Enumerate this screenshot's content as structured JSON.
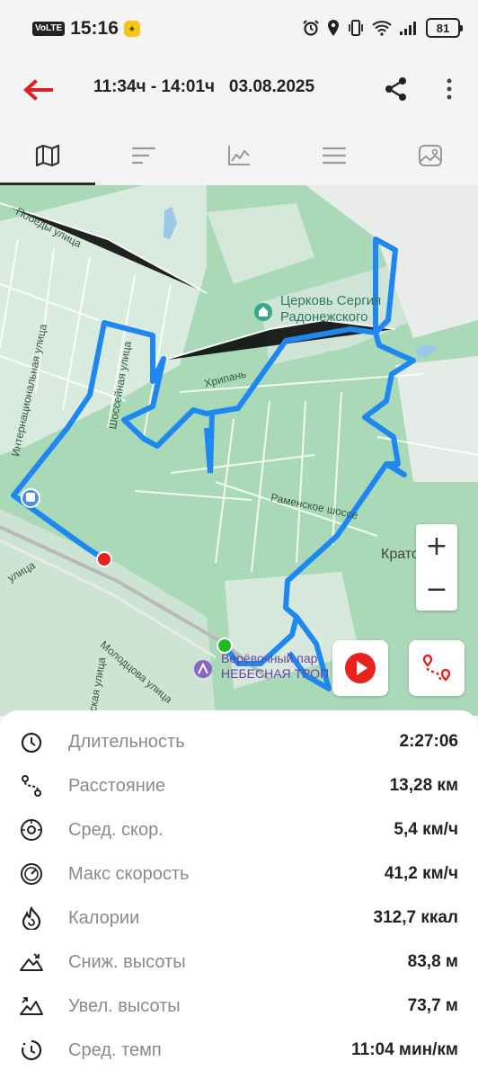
{
  "status_bar": {
    "network": "VoLTE",
    "time": "15:16",
    "notification_icon": "app-notification-icon",
    "battery": "81"
  },
  "header": {
    "title": "11:34ч - 14:01ч   03.08.2025",
    "back_icon": "arrow-left-icon",
    "share_icon": "share-icon",
    "more_icon": "more-vertical-icon"
  },
  "tabs": [
    {
      "icon": "map-icon",
      "active": true
    },
    {
      "icon": "sort-lines-icon",
      "active": false
    },
    {
      "icon": "line-chart-icon",
      "active": false
    },
    {
      "icon": "menu-lines-icon",
      "active": false
    },
    {
      "icon": "photo-icon",
      "active": false
    }
  ],
  "map": {
    "streets": {
      "pobedy": "Победы улица",
      "internatsionalnaya": "Интернациональная улица",
      "shosseynaya": "Шоссейная улица",
      "khripan": "Хрипань",
      "ramenskoe": "Раменское шоссе",
      "ulitsa": "улица",
      "molodtsova": "Молодцова улица",
      "skaya": "ская улица"
    },
    "church": [
      "Церковь Сергия",
      "Радонежского"
    ],
    "park": [
      "Верёвочный пар",
      "НЕБЕСНАЯ ТРОП"
    ],
    "town": "Кратово",
    "zoom_in": "+",
    "zoom_out": "−",
    "colors": {
      "route": "#1e88f0",
      "start": "#22bb22",
      "end": "#e8231e",
      "water": "#9cc8e8"
    }
  },
  "stats": [
    {
      "icon": "stopwatch-icon",
      "label": "Длительность",
      "value": "2:27:06"
    },
    {
      "icon": "route-distance-icon",
      "label": "Расстояние",
      "value": "13,28 км"
    },
    {
      "icon": "speedometer-icon",
      "label": "Сред. скор.",
      "value": "5,4 км/ч"
    },
    {
      "icon": "max-speed-icon",
      "label": "Макс скорость",
      "value": "41,2 км/ч"
    },
    {
      "icon": "calories-flame-icon",
      "label": "Калории",
      "value": "312,7 ккал"
    },
    {
      "icon": "descent-icon",
      "label": "Сниж. высоты",
      "value": "83,8 м"
    },
    {
      "icon": "ascent-icon",
      "label": "Увел. высоты",
      "value": "73,7 м"
    },
    {
      "icon": "pace-timer-icon",
      "label": "Сред. темп",
      "value": "11:04 мин/км"
    }
  ]
}
